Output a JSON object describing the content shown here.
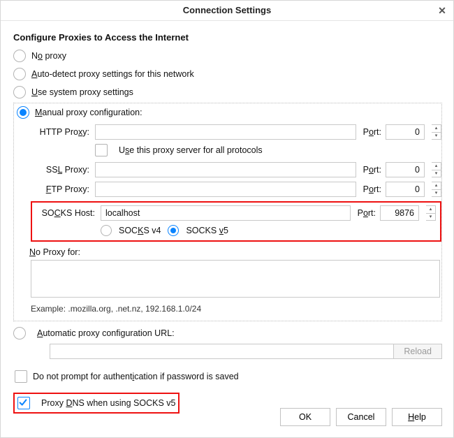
{
  "window": {
    "title": "Connection Settings"
  },
  "section_title": "Configure Proxies to Access the Internet",
  "radios": {
    "no_proxy": {
      "pre": "N",
      "u": "o",
      "post": " proxy"
    },
    "auto_detect": {
      "pre": "",
      "u": "A",
      "post": "uto-detect proxy settings for this network"
    },
    "system": {
      "pre": "",
      "u": "U",
      "post": "se system proxy settings"
    },
    "manual": {
      "pre": "",
      "u": "M",
      "post": "anual proxy configuration:"
    },
    "auto_url": {
      "pre": "",
      "u": "A",
      "post": "utomatic proxy configuration URL:"
    }
  },
  "labels": {
    "http": {
      "pre": "HTTP Pro",
      "u": "x",
      "post": "y:"
    },
    "ssl": {
      "pre": "SS",
      "u": "L",
      "post": " Proxy:"
    },
    "ftp": {
      "pre": "",
      "u": "F",
      "post": "TP Proxy:"
    },
    "socks": {
      "pre": "SO",
      "u": "C",
      "post": "KS Host:"
    },
    "port": {
      "pre": "P",
      "u": "o",
      "post": "rt:"
    },
    "use_all": {
      "pre": "U",
      "u": "s",
      "post": "e this proxy server for all protocols"
    },
    "noproxy": {
      "pre": "",
      "u": "N",
      "post": "o Proxy for:"
    },
    "socks4": {
      "pre": "SOC",
      "u": "K",
      "post": "S v4"
    },
    "socks5": {
      "pre": "SOCKS ",
      "u": "v",
      "post": "5"
    }
  },
  "values": {
    "http_host": "",
    "http_port": "0",
    "ssl_host": "",
    "ssl_port": "0",
    "ftp_host": "",
    "ftp_port": "0",
    "socks_host": "localhost",
    "socks_port": "9876",
    "noproxy": "",
    "auto_url": ""
  },
  "example": "Example: .mozilla.org, .net.nz, 192.168.1.0/24",
  "option_noauth": {
    "pre": "Do not prompt for authent",
    "u": "i",
    "post": "cation if password is saved"
  },
  "option_dns": {
    "pre": "Proxy ",
    "u": "D",
    "post": "NS when using SOCKS v5"
  },
  "buttons": {
    "reload": "Reload",
    "ok": "OK",
    "cancel": "Cancel",
    "help_pre": "",
    "help_u": "H",
    "help_post": "elp"
  }
}
